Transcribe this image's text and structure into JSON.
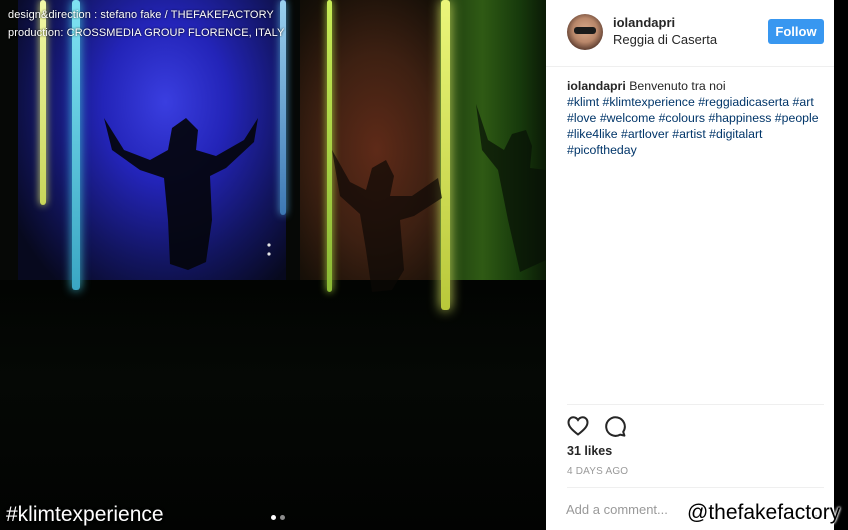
{
  "photo": {
    "credits": [
      "design&direction : stefano fake / THEFAKEFACTORY",
      "production: CROSSMEDIA GROUP FLORENCE, ITALY"
    ],
    "carousel": {
      "count": 2,
      "active": 1
    }
  },
  "overlays": {
    "hashtag": "#klimtexperience",
    "handle": "@thefakefactory"
  },
  "post": {
    "header": {
      "username": "iolandapri",
      "location": "Reggia di Caserta",
      "follow_label": "Follow"
    },
    "caption": {
      "username": "iolandapri",
      "text": "Benvenuto tra noi",
      "hashtags": "#klimt #klimtexperience #reggiadicaserta #art #love #welcome #colours #happiness #people #like4like #artlover #artist #digitalart #picoftheday"
    },
    "actions": {
      "like_icon": "heart-icon",
      "comment_icon": "comment-icon"
    },
    "likes": "31 likes",
    "timestamp": "4 DAYS AGO",
    "comment_placeholder": "Add a comment..."
  },
  "colors": {
    "follow_button": "#3897f0",
    "hashtag_link": "#003569",
    "muted_text": "#999999",
    "divider": "#efefef"
  }
}
